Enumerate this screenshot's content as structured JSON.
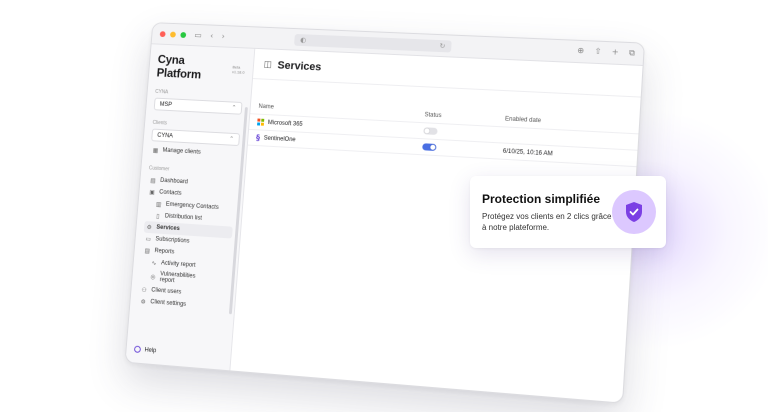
{
  "brand": {
    "name": "Cyna Platform",
    "version": "Beta v1.18.0"
  },
  "sidebar": {
    "org_label": "CYNA",
    "org_select": "MSP",
    "clients_label": "Clients",
    "client_select": "CYNA",
    "manage_clients": "Manage clients",
    "customer_label": "Customer",
    "items": [
      {
        "label": "Dashboard",
        "icon": "dashboard-icon"
      },
      {
        "label": "Contacts",
        "icon": "contacts-icon"
      },
      {
        "label": "Emergency Contacts",
        "icon": "emergency-icon"
      },
      {
        "label": "Distribution list",
        "icon": "list-icon"
      },
      {
        "label": "Services",
        "icon": "services-icon"
      },
      {
        "label": "Subscriptions",
        "icon": "subscriptions-icon"
      },
      {
        "label": "Reports",
        "icon": "reports-icon"
      },
      {
        "label": "Activity report",
        "icon": "activity-icon"
      },
      {
        "label": "Vulnerabilities report",
        "icon": "vuln-icon"
      },
      {
        "label": "Client users",
        "icon": "users-icon"
      },
      {
        "label": "Client settings",
        "icon": "settings-icon"
      }
    ],
    "help": "Help"
  },
  "main": {
    "title": "Services",
    "columns": {
      "name": "Name",
      "status": "Status",
      "enabled": "Enabled date"
    },
    "rows": [
      {
        "name": "Microsoft 365",
        "enabled": false,
        "date": ""
      },
      {
        "name": "SentinelOne",
        "enabled": true,
        "date": "6/10/25, 10:16 AM"
      }
    ]
  },
  "card": {
    "title": "Protection simplifiée",
    "text": "Protégez vos clients en 2 clics grâce à notre plateforme."
  },
  "colors": {
    "accent": "#6c4bd8",
    "toggle_on": "#4a6fe3",
    "shield_bg": "#dcc8ff",
    "shield": "#7b3fe4"
  }
}
